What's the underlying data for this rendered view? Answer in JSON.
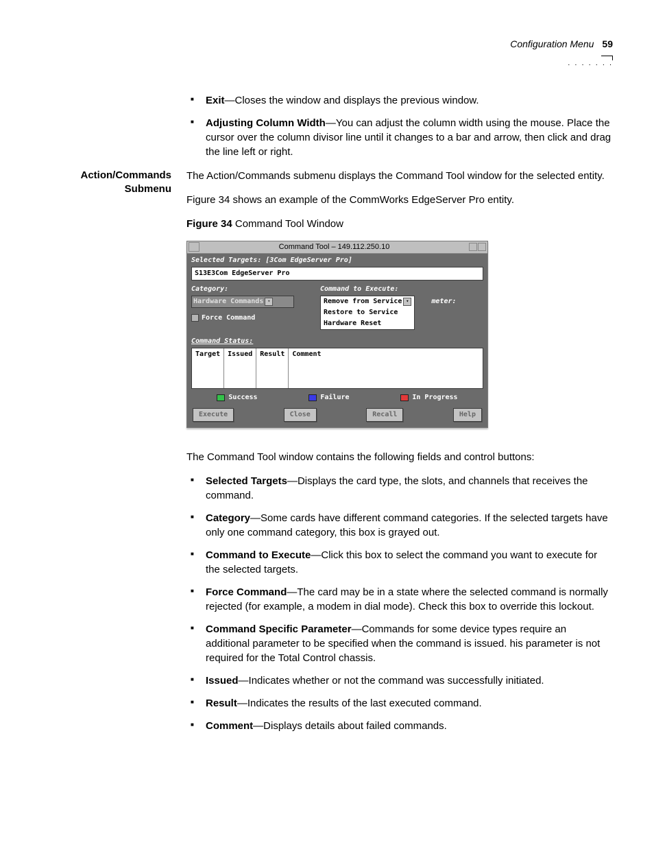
{
  "header": {
    "section": "Configuration Menu",
    "page": "59"
  },
  "intro_bullets": [
    {
      "term": "Exit",
      "desc": "—Closes the window and displays the previous window."
    },
    {
      "term": "Adjusting Column Width",
      "desc": "—You can adjust the column width using the mouse. Place the cursor over the column divisor line until it changes to a bar and arrow, then click and drag the line left or right."
    }
  ],
  "subsection": {
    "margin_heading": "Action/Commands\nSubmenu",
    "para1": "The Action/Commands submenu displays the Command Tool window for the selected entity.",
    "para2": "Figure 34 shows an example of the CommWorks EdgeServer Pro entity.",
    "fig_caption_num": "Figure 34",
    "fig_caption_text": "  Command Tool Window"
  },
  "cmdtool": {
    "title": "Command Tool – 149.112.250.10",
    "selected_targets_label": "Selected Targets:  [3Com EdgeServer Pro]",
    "selected_target_value": "S13E3Com EdgeServer Pro",
    "category_label": "Category:",
    "category_value": "Hardware Commands",
    "force_command_label": "Force Command",
    "cte_label": "Command to Execute:",
    "cte_options": [
      "Remove from Service",
      "Restore to Service",
      "Hardware Reset"
    ],
    "meter_label": "meter:",
    "status_label": "Command Status:",
    "table_headers": [
      "Target",
      "Issued",
      "Result",
      "Comment"
    ],
    "legend": [
      {
        "label": "Success",
        "color": "#34c04a"
      },
      {
        "label": "Failure",
        "color": "#3a3ae6"
      },
      {
        "label": "In Progress",
        "color": "#e23a3a"
      }
    ],
    "buttons": [
      "Execute",
      "Close",
      "Recall",
      "Help"
    ]
  },
  "body_after_fig": "The Command Tool window contains the following fields and control buttons:",
  "field_bullets": [
    {
      "term": "Selected Targets",
      "desc": "—Displays the card type, the slots, and channels that receives the command."
    },
    {
      "term": "Category",
      "desc": "—Some cards have different command categories. If the selected targets have only one command category, this box is grayed out."
    },
    {
      "term": "Command to Execute",
      "desc": "—Click this box to select the command you want to execute for the selected targets."
    },
    {
      "term": "Force Command",
      "desc": "—The card may be in a state where the selected command is normally rejected (for example, a modem in dial mode). Check this box to override this lockout."
    },
    {
      "term": "Command Specific Parameter",
      "desc": "—Commands for some device types require an additional parameter to be specified when the command is issued. his parameter is not required for the Total Control chassis."
    },
    {
      "term": "Issued",
      "desc": "—Indicates whether or not the command was successfully initiated."
    },
    {
      "term": "Result",
      "desc": "—Indicates the results of the last executed command."
    },
    {
      "term": "Comment",
      "desc": "—Displays details about failed commands."
    }
  ]
}
